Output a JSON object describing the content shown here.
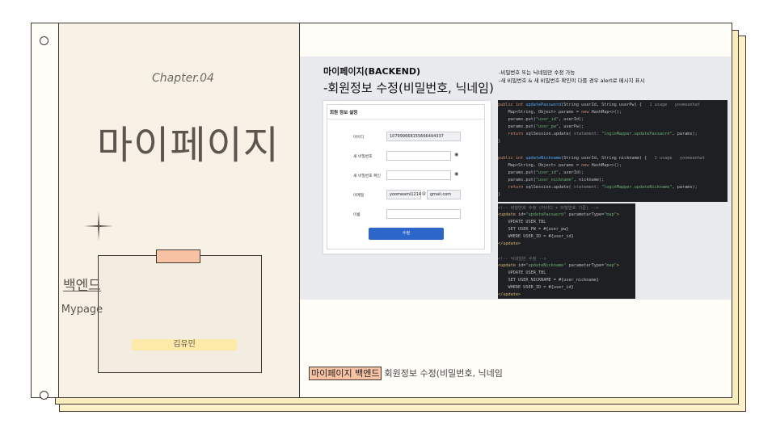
{
  "cover": {
    "chapter": "Chapter.04",
    "title": "마이페이지",
    "card_title": "백엔드",
    "card_subtitle": "Mypage",
    "author": "김유민"
  },
  "content": {
    "heading": "마이페이지(BACKEND)",
    "subheading": "-회원정보 수정(비밀번호, 닉네임)",
    "notes": [
      "-비밀번호 또는 닉네임만 수정 가능",
      "-새 비밀번호 & 새 비밀번호 확인이 다를 경우 alert로 메시지 표시"
    ]
  },
  "form": {
    "header": "회원 정보 설정",
    "fields": [
      {
        "label": "아이디",
        "value": "107999668155666494337"
      },
      {
        "label": "새 비밀번호",
        "value": ""
      },
      {
        "label": "새 비밀번호 확인",
        "value": ""
      },
      {
        "label": "이메일",
        "value": "yoomeami1214",
        "at": "@",
        "domain": "gmail.com"
      },
      {
        "label": "이름",
        "value": ""
      }
    ],
    "submit_label": "수정"
  },
  "java_code": [
    "public int updatePassword(String userId, String userPw) {   1 usage   yoomeanhat",
    "    Map<String, Object> params = new HashMap<>();",
    "    params.put(\"user_id\", userId);",
    "    params.put(\"user_pw\", userPw);",
    "    return sqlSession.update( statement: \"loginMapper.updatePassword\", params);",
    "}",
    "",
    "public int updateNickname(String userId, String nickname) {   1 usage   yoomeanhat",
    "    Map<String, Object> params = new HashMap<>();",
    "    params.put(\"user_id\", userId);",
    "    params.put(\"user_nickname\", nickname);",
    "    return sqlSession.update( statement: \"loginMapper.updateNickname\", params);",
    "}"
  ],
  "xml_code": [
    "<!-- 비밀번호 수정 (아이디 + 비밀번호 기준) -->",
    "<update id=\"updatePassword\" parameterType=\"map\">",
    "    UPDATE USER_TBL",
    "    SET USER_PW = #{user_pw}",
    "    WHERE USER_ID = #{user_id}",
    "</update>",
    "",
    "<!-- 닉네임만 수정 -->",
    "<update id=\"updateNickname\" parameterType=\"map\">",
    "    UPDATE USER_TBL",
    "    SET USER_NICKNAME = #{user_nickname}",
    "    WHERE USER_ID = #{user_id}",
    "</update>"
  ],
  "footer": {
    "highlight": "마이페이지 백엔드",
    "text": "회원정보 수정(비밀번호, 닉네임"
  },
  "colors": {
    "accent_tape": "#f7c3a4",
    "author_highlight": "#fde9a8",
    "back_sheet": "#faedbd",
    "button": "#2c66c9",
    "code_bg": "#1e1f22"
  }
}
